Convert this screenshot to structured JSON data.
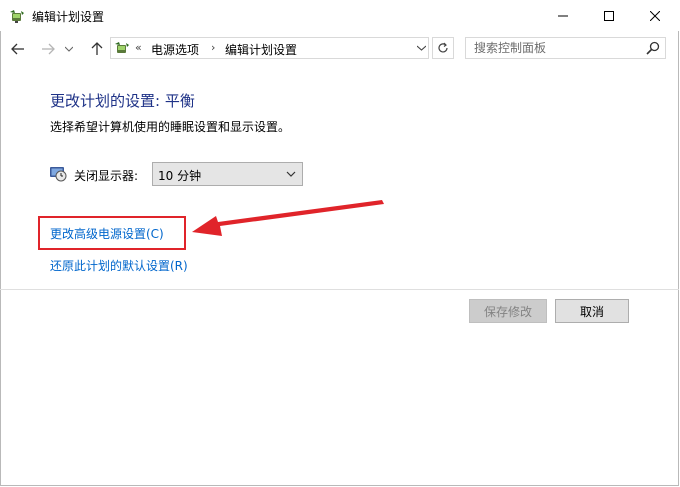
{
  "window": {
    "title": "编辑计划设置"
  },
  "nav": {
    "crumb_sep": "«",
    "breadcrumbs": [
      "电源选项",
      "编辑计划设置"
    ],
    "crumb_arrow": "›",
    "search_placeholder": "搜索控制面板"
  },
  "main": {
    "heading": "更改计划的设置: 平衡",
    "subtext": "选择希望计算机使用的睡眠设置和显示设置。",
    "display_label": "关闭显示器:",
    "display_value": "10 分钟",
    "advanced_link": "更改高级电源设置(C)",
    "restore_link": "还原此计划的默认设置(R)"
  },
  "buttons": {
    "save": "保存修改",
    "cancel": "取消"
  },
  "colors": {
    "heading": "#1e3287",
    "link": "#0066cc",
    "annotation": "#e0242a"
  }
}
